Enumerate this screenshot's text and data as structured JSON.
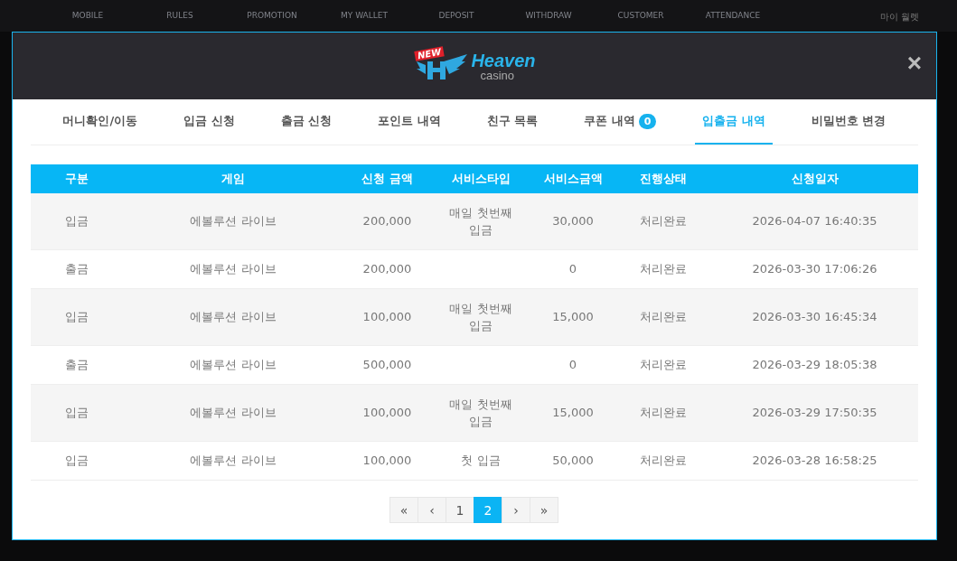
{
  "background_nav": {
    "items": [
      "MOBILE",
      "RULES",
      "PROMOTION",
      "MY WALLET",
      "DEPOSIT",
      "WITHDRAW",
      "CUSTOMER",
      "ATTENDANCE"
    ],
    "side_title": "마이 월렛"
  },
  "modal": {
    "logo": {
      "badge": "NEW",
      "name": "Heaven",
      "sub": "casino"
    },
    "close": "×",
    "tabs": [
      {
        "label": "머니확인/이동",
        "selected": false
      },
      {
        "label": "입금 신청",
        "selected": false
      },
      {
        "label": "출금 신청",
        "selected": false
      },
      {
        "label": "포인트 내역",
        "selected": false
      },
      {
        "label": "친구 목록",
        "selected": false
      },
      {
        "label": "쿠폰 내역",
        "badge": "0",
        "selected": false
      },
      {
        "label": "입출금 내역",
        "selected": true
      },
      {
        "label": "비밀번호 변경",
        "selected": false
      }
    ],
    "table": {
      "columns": [
        "구분",
        "게임",
        "신청 금액",
        "서비스타입",
        "서비스금액",
        "진행상태",
        "신청일자"
      ],
      "rows": [
        [
          "입금",
          "에볼루션 라이브",
          "200,000",
          "매일 첫번째 입금",
          "30,000",
          "처리완료",
          "2026-04-07 16:40:35"
        ],
        [
          "출금",
          "에볼루션 라이브",
          "200,000",
          "",
          "0",
          "처리완료",
          "2026-03-30 17:06:26"
        ],
        [
          "입금",
          "에볼루션 라이브",
          "100,000",
          "매일 첫번째 입금",
          "15,000",
          "처리완료",
          "2026-03-30 16:45:34"
        ],
        [
          "출금",
          "에볼루션 라이브",
          "500,000",
          "",
          "0",
          "처리완료",
          "2026-03-29 18:05:38"
        ],
        [
          "입금",
          "에볼루션 라이브",
          "100,000",
          "매일 첫번째 입금",
          "15,000",
          "처리완료",
          "2026-03-29 17:50:35"
        ],
        [
          "입금",
          "에볼루션 라이브",
          "100,000",
          "첫 입금",
          "50,000",
          "처리완료",
          "2026-03-28 16:58:25"
        ]
      ]
    },
    "pagination": [
      {
        "label": "«",
        "selected": false
      },
      {
        "label": "‹",
        "selected": false
      },
      {
        "label": "1",
        "selected": false
      },
      {
        "label": "2",
        "selected": true
      },
      {
        "label": "›",
        "selected": false
      },
      {
        "label": "»",
        "selected": false
      }
    ]
  }
}
